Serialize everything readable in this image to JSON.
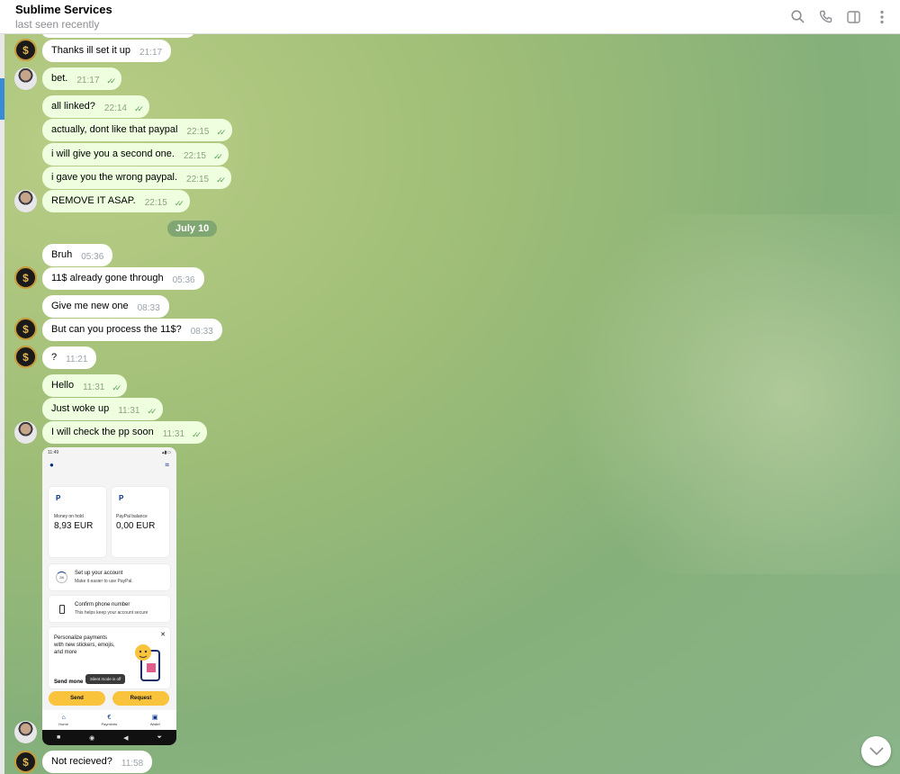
{
  "header": {
    "title": "Sublime Services",
    "status": "last seen recently",
    "icons": [
      "search-icon",
      "phone-icon",
      "sidebar-toggle-icon",
      "more-vertical-icon"
    ]
  },
  "date_separator": "July 10",
  "messages": [
    {
      "text": "Thanks ill set it up",
      "time": "21:17"
    },
    {
      "text": "bet.",
      "time": "21:17"
    },
    {
      "text": "all linked?",
      "time": "22:14"
    },
    {
      "text": "actually, dont like that paypal",
      "time": "22:15"
    },
    {
      "text": "i will give you a second one.",
      "time": "22:15"
    },
    {
      "text": "i gave you the wrong paypal.",
      "time": "22:15"
    },
    {
      "text": "REMOVE IT ASAP.",
      "time": "22:15"
    },
    {
      "text": "Bruh",
      "time": "05:36"
    },
    {
      "text": "11$ already gone through",
      "time": "05:36"
    },
    {
      "text": "Give me new one",
      "time": "08:33"
    },
    {
      "text": "But can you process the 11$?",
      "time": "08:33"
    },
    {
      "text": "?",
      "time": "11:21"
    },
    {
      "text": "Hello",
      "time": "11:31"
    },
    {
      "text": "Just woke up",
      "time": "11:31"
    },
    {
      "text": "I will check the pp soon",
      "time": "11:31"
    },
    {
      "text": "Not recieved?",
      "time": "11:58"
    }
  ],
  "screenshot": {
    "status_time": "11:49",
    "card1_label": "Money on hold",
    "card1_amount": "8,93 EUR",
    "card2_label": "PayPal balance",
    "card2_amount": "0,00 EUR",
    "setup_progress": "2/6",
    "setup_title": "Set up your account",
    "setup_sub": "Make it easier to use PayPal.",
    "confirm_title": "Confirm phone number",
    "confirm_sub": "This helps keep your account secure",
    "promo_text": "Personalize payments with new stickers, emojis, and more",
    "promo_cut": "Send mone",
    "toast": "Silent mode is off",
    "send": "Send",
    "request": "Request",
    "nav_home": "Home",
    "nav_payments": "Payments",
    "nav_wallet": "Wallet"
  }
}
